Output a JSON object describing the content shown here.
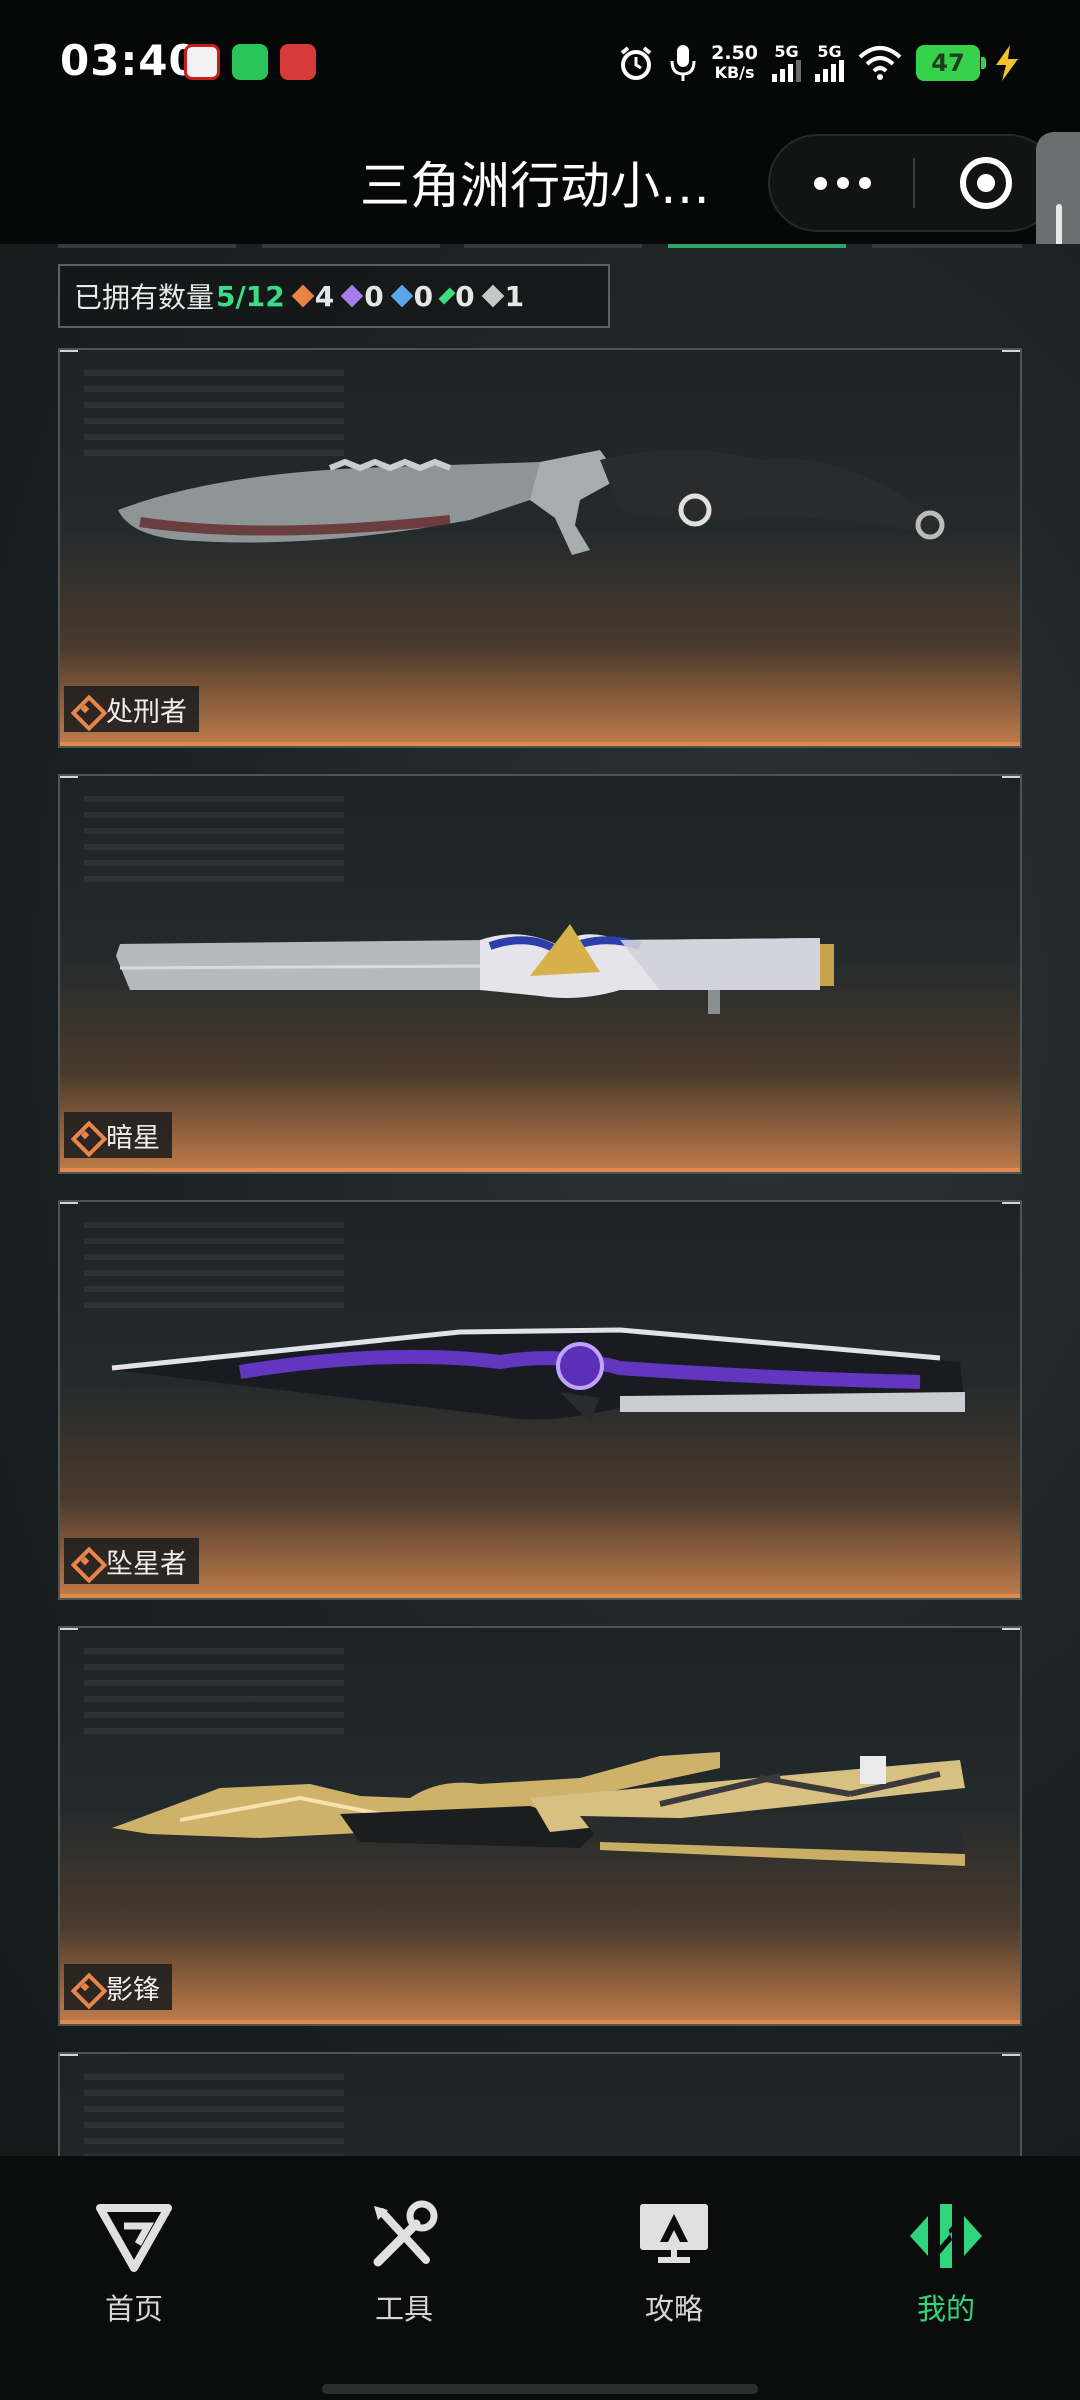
{
  "status_bar": {
    "time": "03:40",
    "net_speed_value": "2.50",
    "net_speed_unit": "KB/s",
    "sim1_label": "5G",
    "sim2_label": "5G",
    "battery": "47"
  },
  "header": {
    "title": "三角洲行动小…"
  },
  "summary": {
    "owned_label": "已拥有数量",
    "owned_count": "5/12",
    "rarity_counts": [
      {
        "icon": "orange-diamond-icon",
        "color": "#e8864a",
        "count": "4"
      },
      {
        "icon": "purple-diamond-icon",
        "color": "#a77be8",
        "count": "0"
      },
      {
        "icon": "blue-diamond-icon",
        "color": "#5aa6e8",
        "count": "0"
      },
      {
        "icon": "green-diamond-icon",
        "color": "#3ddc84",
        "count": "0"
      },
      {
        "icon": "gray-diamond-icon",
        "color": "#c8c8c8",
        "count": "1"
      }
    ]
  },
  "knives": [
    {
      "name": "处刑者",
      "rarity_color": "#e8864a"
    },
    {
      "name": "暗星",
      "rarity_color": "#e8864a"
    },
    {
      "name": "坠星者",
      "rarity_color": "#e8864a"
    },
    {
      "name": "影锋",
      "rarity_color": "#e8864a"
    }
  ],
  "bottom_nav": [
    {
      "label": "首页",
      "icon": "delta-logo-icon",
      "active": false
    },
    {
      "label": "工具",
      "icon": "tools-icon",
      "active": false
    },
    {
      "label": "攻略",
      "icon": "guide-monitor-icon",
      "active": false
    },
    {
      "label": "我的",
      "icon": "profile-emblem-icon",
      "active": true
    }
  ],
  "colors": {
    "accent_green": "#2fd47c",
    "rarity_orange": "#e8864a",
    "background": "#1a1f21"
  }
}
